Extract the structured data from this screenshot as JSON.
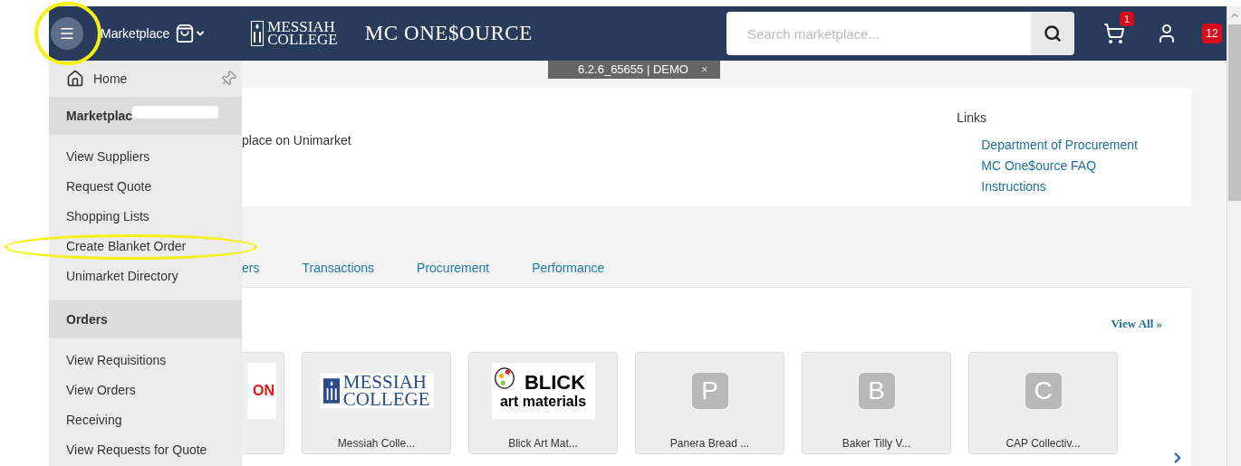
{
  "header": {
    "menu_button_highlighted": true,
    "marketplace_label": "Marketplace",
    "logo_lines": [
      "MESSIAH",
      "COLLEGE"
    ],
    "title": "MC ONE$OURCE",
    "search": {
      "placeholder": "Search marketplace..."
    },
    "cart_count": "1",
    "notifications_count": "12"
  },
  "version_tag": {
    "text": "6.2.6_65655 | DEMO",
    "close": "×"
  },
  "menu": {
    "home": "Home",
    "sections": [
      {
        "title": "Marketplac",
        "redacted": true,
        "items": [
          {
            "label": "View Suppliers",
            "highlighted": false
          },
          {
            "label": "Request Quote",
            "highlighted": false
          },
          {
            "label": "Shopping Lists",
            "highlighted": false
          },
          {
            "label": "Create Blanket Order",
            "highlighted": true
          },
          {
            "label": "Unimarket Directory",
            "highlighted": false
          }
        ]
      },
      {
        "title": "Orders",
        "redacted": false,
        "items": [
          {
            "label": "View Requisitions",
            "highlighted": false
          },
          {
            "label": "View Orders",
            "highlighted": false
          },
          {
            "label": "Receiving",
            "highlighted": false
          },
          {
            "label": "View Requests for Quote",
            "highlighted": false
          }
        ]
      }
    ]
  },
  "intro": {
    "text": "place on Unimarket"
  },
  "links": {
    "title": "Links",
    "items": [
      "Department of Procurement",
      "MC One$ource FAQ",
      "Instructions"
    ]
  },
  "tabs": [
    "ers",
    "Transactions",
    "Procurement",
    "Performance"
  ],
  "suppliers": {
    "view_all": "View All »",
    "tiles": [
      {
        "kind": "wordmark",
        "logo": [
          "ON"
        ]
      },
      {
        "kind": "messiah",
        "logo": [
          "MESSIAH",
          "COLLEGE"
        ],
        "name": "Messiah Colle..."
      },
      {
        "kind": "blick",
        "logo": [
          "BLICK",
          "art materials"
        ],
        "name": "Blick Art Mat..."
      },
      {
        "kind": "letter",
        "logo": [
          "P"
        ],
        "name": "Panera Bread ..."
      },
      {
        "kind": "letter",
        "logo": [
          "B"
        ],
        "name": "Baker Tilly V..."
      },
      {
        "kind": "letter",
        "logo": [
          "C"
        ],
        "name": "CAP Collectiv..."
      }
    ]
  }
}
